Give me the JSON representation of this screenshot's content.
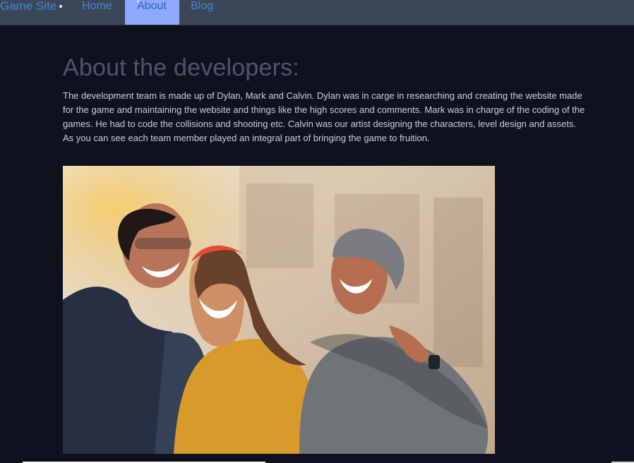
{
  "nav": {
    "brand": "Game Site",
    "items": [
      {
        "label": "Home",
        "active": false
      },
      {
        "label": "About",
        "active": true
      },
      {
        "label": "Blog",
        "active": false
      }
    ]
  },
  "main": {
    "title": "About the developers:",
    "intro": "The development team is made up of Dylan, Mark and Calvin. Dylan was in carge in researching and creating the website made for the game and maintaining the website and things like the high scores and comments. Mark was in charge of the coding of the games. He had to code the collisions and shooting etc. Calvin was our artist designing the characters, level design and assets. As you can see each team member played an integral part of bringing the game to fruition."
  },
  "colors": {
    "page_background": "#10111f",
    "navbar_background": "#3b4659",
    "link": "#3f87d6",
    "active_tab": "#8ea7ff",
    "title": "#4c556d",
    "body_text": "#c9cfdb"
  }
}
